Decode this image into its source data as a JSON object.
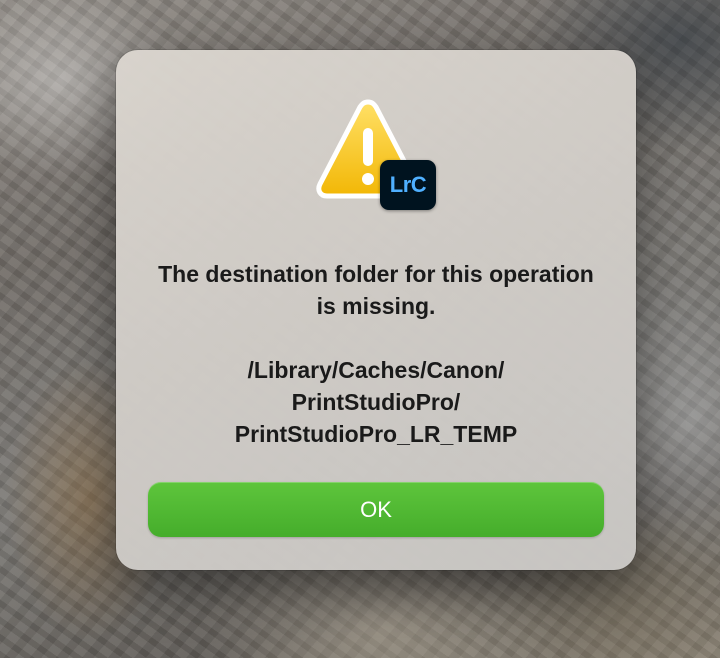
{
  "dialog": {
    "message": "The destination folder for this operation is missing.",
    "path_lines": [
      "/Library/Caches/Canon/",
      "PrintStudioPro/",
      "PrintStudioPro_LR_TEMP"
    ],
    "ok_label": "OK",
    "icon": "warning-icon",
    "app_badge": {
      "icon": "lightroom-classic-icon",
      "label": "LrC",
      "background": "#00131f",
      "text_color": "#4fb0ff"
    },
    "colors": {
      "button": "#4cb731",
      "warning_yellow": "#f4c21e"
    }
  }
}
